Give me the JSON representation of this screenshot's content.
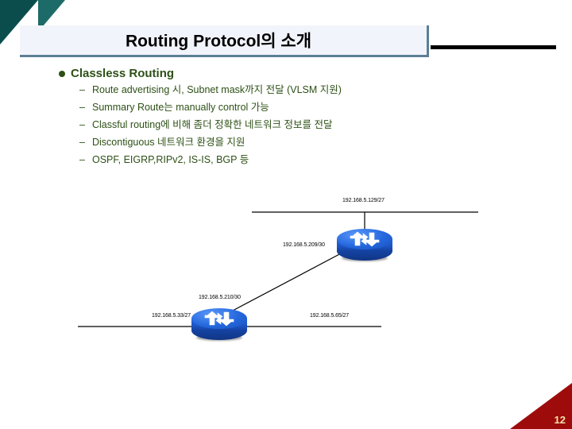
{
  "slide": {
    "title": "Routing Protocol의 소개",
    "page_number": "12",
    "accent_color": "#5b7f95",
    "bullet_color": "#2d5016",
    "badge_color": "#9e0b0b",
    "corner_color": "#0b4d4d"
  },
  "content": {
    "level1": {
      "label": "Classless Routing",
      "bullet_glyph": "●"
    },
    "sub_bullets": [
      {
        "dash": "–",
        "text": "Route advertising 시, Subnet mask까지 전달 (VLSM 지원)"
      },
      {
        "dash": "–",
        "text": "Summary Route는 manually control 가능"
      },
      {
        "dash": "–",
        "text": "Classful routing에 비해 좀더 정확한 네트워크 정보를 전달"
      },
      {
        "dash": "–",
        "text": "Discontiguous 네트워크 환경을 지원"
      },
      {
        "dash": "–",
        "text": "OSPF, EIGRP,RIPv2, IS-IS, BGP 등"
      }
    ]
  },
  "diagram": {
    "labels": {
      "top_segment": "192.168.5.129/27",
      "upper_link": "192.168.5.209/30",
      "lower_link": "192.168.5.210/30",
      "left_segment": "192.168.5.33/27",
      "right_segment": "192.168.5.65/27"
    },
    "routers": [
      {
        "name": "upper-router"
      },
      {
        "name": "lower-router"
      }
    ]
  }
}
